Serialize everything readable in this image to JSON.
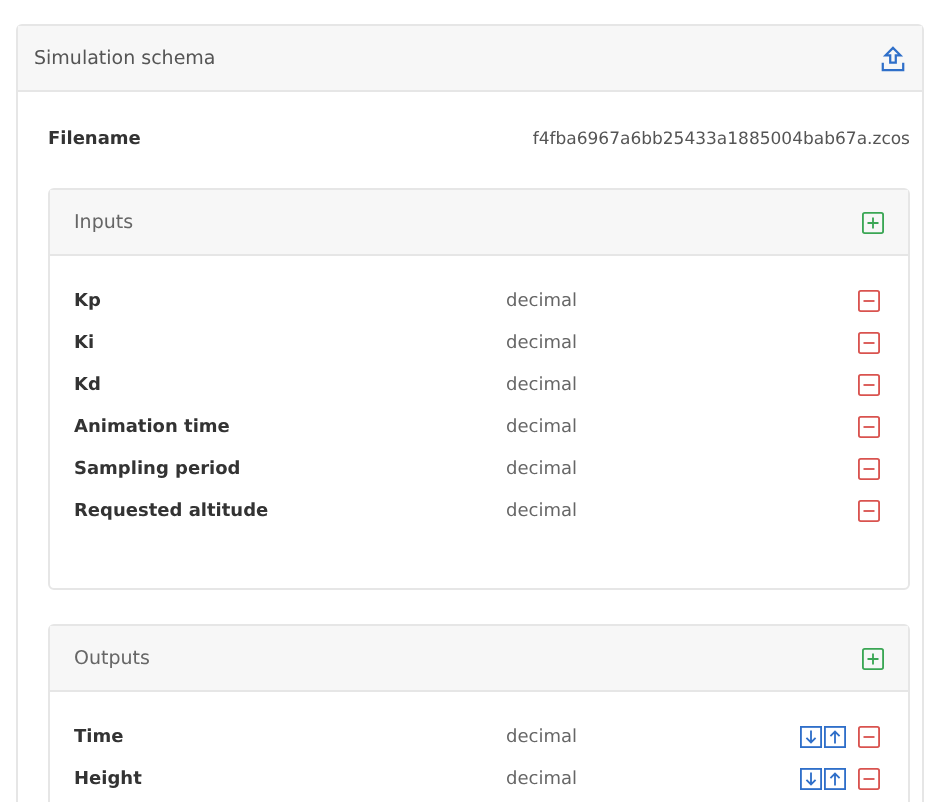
{
  "panel": {
    "title": "Simulation schema"
  },
  "filename": {
    "label": "Filename",
    "value": "f4fba6967a6bb25433a1885004bab67a.zcos"
  },
  "sections": [
    {
      "title": "Inputs",
      "kind": "inputs",
      "rows": [
        {
          "name": "Kp",
          "type": "decimal"
        },
        {
          "name": "Ki",
          "type": "decimal"
        },
        {
          "name": "Kd",
          "type": "decimal"
        },
        {
          "name": "Animation time",
          "type": "decimal"
        },
        {
          "name": "Sampling period",
          "type": "decimal"
        },
        {
          "name": "Requested altitude",
          "type": "decimal"
        }
      ]
    },
    {
      "title": "Outputs",
      "kind": "outputs",
      "rows": [
        {
          "name": "Time",
          "type": "decimal"
        },
        {
          "name": "Height",
          "type": "decimal"
        }
      ]
    }
  ]
}
